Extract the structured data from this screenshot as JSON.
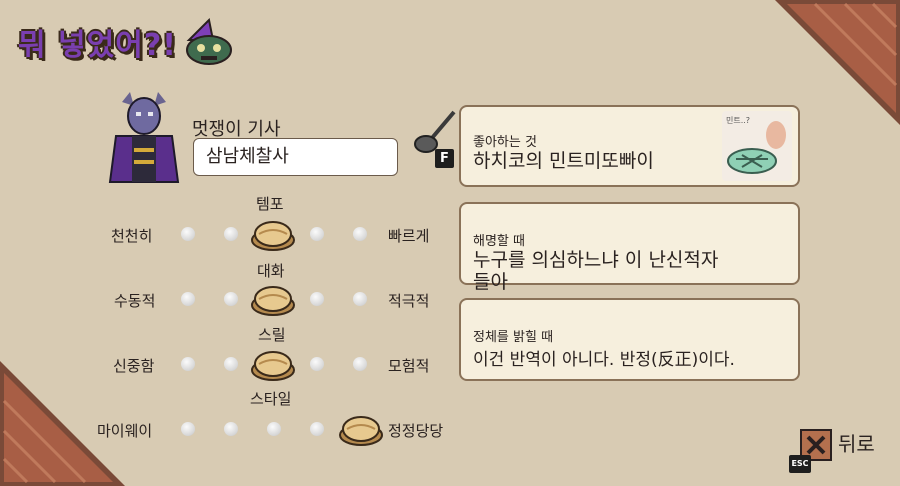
{
  "header": {
    "logo_text": "뭐 넣었어?!"
  },
  "character": {
    "label": "멋쟁이 기사",
    "name_value": "삼남체찰사"
  },
  "hotkeys": {
    "interact_key": "F",
    "escape_key": "ESC"
  },
  "cards": [
    {
      "label": "좋아하는 것",
      "value": "하치코의 민트미또빠이"
    },
    {
      "label": "해명할 때",
      "value": "누구를 의심하느냐 이 난신적자",
      "value_2": "들아"
    },
    {
      "label": "정체를 밝힐 때",
      "value": "이건 반역이 아니다. 반정(反正)이다."
    }
  ],
  "card_image_text": "민트..?",
  "sliders": [
    {
      "title": "템포",
      "left": "천천히",
      "right": "빠르게",
      "level": 2,
      "steps": 5
    },
    {
      "title": "대화",
      "left": "수동적",
      "right": "적극적",
      "level": 2,
      "steps": 5
    },
    {
      "title": "스릴",
      "left": "신중함",
      "right": "모험적",
      "level": 2,
      "steps": 5
    },
    {
      "title": "스타일",
      "left": "마이웨이",
      "right": "정정당당",
      "level": 4,
      "steps": 5
    }
  ],
  "back_button": {
    "label": "뒤로"
  }
}
